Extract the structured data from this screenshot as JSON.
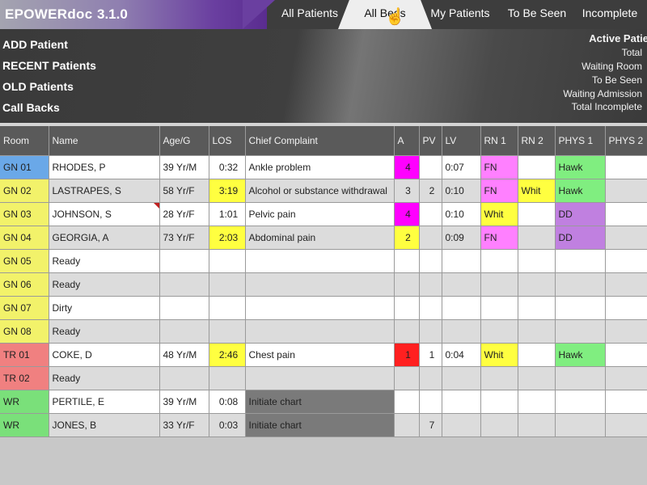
{
  "app": {
    "name": "EPOWERdoc",
    "version": "3.1.0"
  },
  "tabs": [
    "All Patients",
    "All Beds",
    "My Patients",
    "To Be Seen",
    "Incomplete"
  ],
  "menu": [
    "ADD Patient",
    "RECENT Patients",
    "OLD Patients",
    "Call Backs"
  ],
  "stats": {
    "title": "Active Patie",
    "items": [
      "Total",
      "Waiting Room",
      "To Be Seen",
      "Waiting Admission",
      "Total Incomplete"
    ]
  },
  "columns": [
    "Room",
    "Name",
    "Age/G",
    "LOS",
    "Chief Complaint",
    "A",
    "PV",
    "LV",
    "RN 1",
    "RN 2",
    "PHYS 1",
    "PHYS 2"
  ],
  "rows": [
    [
      "GN 01",
      "RHODES, P",
      "39 Yr/M",
      "0:32",
      "Ankle problem",
      "4",
      "",
      "0:07",
      "FN",
      "",
      "Hawk",
      ""
    ],
    [
      "GN 02",
      "LASTRAPES, S",
      "58 Yr/F",
      "3:19",
      "Alcohol or substance withdrawal",
      "3",
      "2",
      "0:10",
      "FN",
      "Whit",
      "Hawk",
      ""
    ],
    [
      "GN 03",
      "JOHNSON, S",
      "28 Yr/F",
      "1:01",
      "Pelvic pain",
      "4",
      "",
      "0:10",
      "Whit",
      "",
      "DD",
      ""
    ],
    [
      "GN 04",
      "GEORGIA, A",
      "73 Yr/F",
      "2:03",
      "Abdominal pain",
      "2",
      "",
      "0:09",
      "FN",
      "",
      "DD",
      ""
    ],
    [
      "GN 05",
      "Ready",
      "",
      "",
      "",
      "",
      "",
      "",
      "",
      "",
      "",
      ""
    ],
    [
      "GN 06",
      "Ready",
      "",
      "",
      "",
      "",
      "",
      "",
      "",
      "",
      "",
      ""
    ],
    [
      "GN 07",
      "Dirty",
      "",
      "",
      "",
      "",
      "",
      "",
      "",
      "",
      "",
      ""
    ],
    [
      "GN 08",
      "Ready",
      "",
      "",
      "",
      "",
      "",
      "",
      "",
      "",
      "",
      ""
    ],
    [
      "TR 01",
      "COKE, D",
      "48 Yr/M",
      "2:46",
      "Chest pain",
      "1",
      "1",
      "0:04",
      "Whit",
      "",
      "Hawk",
      ""
    ],
    [
      "TR 02",
      "Ready",
      "",
      "",
      "",
      "",
      "",
      "",
      "",
      "",
      "",
      ""
    ],
    [
      "WR",
      "PERTILE, E",
      "39 Yr/M",
      "0:08",
      "Initiate chart",
      "",
      "",
      "",
      "",
      "",
      "",
      ""
    ],
    [
      "WR",
      "JONES, B",
      "33 Yr/F",
      "0:03",
      "Initiate chart",
      "",
      "7",
      "",
      "",
      "",
      "",
      ""
    ]
  ],
  "colors": {
    "gn_room": "#f2f26a",
    "tr_room": "#f08080",
    "wr_room": "#7ae07a",
    "acuity_magenta": "#ff00ff",
    "acuity_yellow": "#ffff40",
    "acuity_red": "#ff2020",
    "rn_pink": "#ff80ff",
    "phys_green": "#80ee80",
    "phys_purple": "#c080e0"
  },
  "icons": {
    "cursor": "hand-pointer-icon"
  }
}
